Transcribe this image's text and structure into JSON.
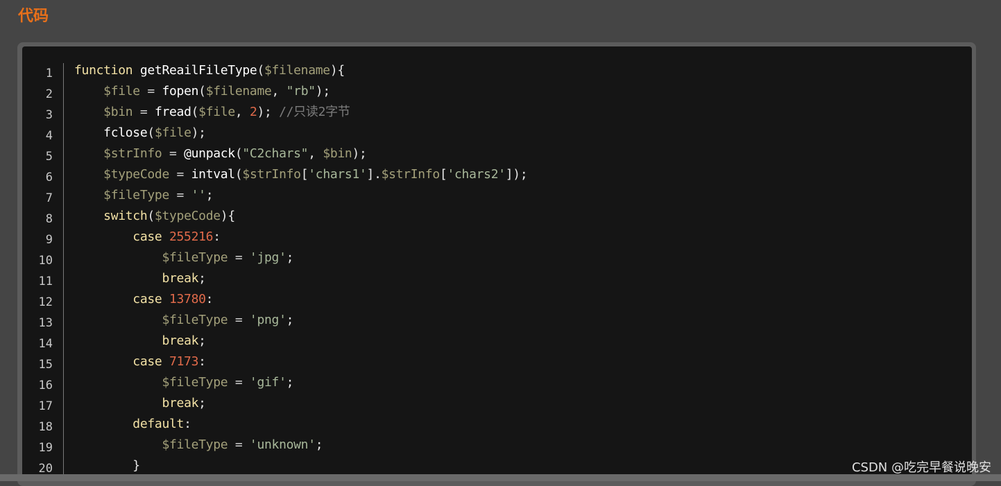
{
  "section_title": "代码",
  "watermark": "CSDN @吃完早餐说晚安",
  "code": {
    "line_numbers": [
      "1",
      "2",
      "3",
      "4",
      "5",
      "6",
      "7",
      "8",
      "9",
      "10",
      "11",
      "12",
      "13",
      "14",
      "15",
      "16",
      "17",
      "18",
      "19",
      "20"
    ],
    "lines": [
      [
        [
          "kw",
          "function "
        ],
        [
          "fn",
          "getReailFileType"
        ],
        [
          "punc",
          "("
        ],
        [
          "var",
          "$filename"
        ],
        [
          "punc",
          "){"
        ]
      ],
      [
        [
          "punc",
          "    "
        ],
        [
          "var",
          "$file"
        ],
        [
          "op",
          " = "
        ],
        [
          "fn",
          "fopen"
        ],
        [
          "punc",
          "("
        ],
        [
          "var",
          "$filename"
        ],
        [
          "punc",
          ", "
        ],
        [
          "str",
          "\"rb\""
        ],
        [
          "punc",
          ");"
        ]
      ],
      [
        [
          "punc",
          "    "
        ],
        [
          "var",
          "$bin"
        ],
        [
          "op",
          " = "
        ],
        [
          "fn",
          "fread"
        ],
        [
          "punc",
          "("
        ],
        [
          "var",
          "$file"
        ],
        [
          "punc",
          ", "
        ],
        [
          "num",
          "2"
        ],
        [
          "punc",
          "); "
        ],
        [
          "cm",
          "//只读2字节"
        ]
      ],
      [
        [
          "punc",
          "    "
        ],
        [
          "fn",
          "fclose"
        ],
        [
          "punc",
          "("
        ],
        [
          "var",
          "$file"
        ],
        [
          "punc",
          ");"
        ]
      ],
      [
        [
          "punc",
          "    "
        ],
        [
          "var",
          "$strInfo"
        ],
        [
          "op",
          " = "
        ],
        [
          "fn",
          "@unpack"
        ],
        [
          "punc",
          "("
        ],
        [
          "str",
          "\"C2chars\""
        ],
        [
          "punc",
          ", "
        ],
        [
          "var",
          "$bin"
        ],
        [
          "punc",
          ");"
        ]
      ],
      [
        [
          "punc",
          "    "
        ],
        [
          "var",
          "$typeCode"
        ],
        [
          "op",
          " = "
        ],
        [
          "fn",
          "intval"
        ],
        [
          "punc",
          "("
        ],
        [
          "var",
          "$strInfo"
        ],
        [
          "punc",
          "["
        ],
        [
          "str",
          "'chars1'"
        ],
        [
          "punc",
          "]."
        ],
        [
          "var",
          "$strInfo"
        ],
        [
          "punc",
          "["
        ],
        [
          "str",
          "'chars2'"
        ],
        [
          "punc",
          "]);"
        ]
      ],
      [
        [
          "punc",
          "    "
        ],
        [
          "var",
          "$fileType"
        ],
        [
          "op",
          " = "
        ],
        [
          "str",
          "''"
        ],
        [
          "punc",
          ";"
        ]
      ],
      [
        [
          "punc",
          "    "
        ],
        [
          "kw",
          "switch"
        ],
        [
          "punc",
          "("
        ],
        [
          "var",
          "$typeCode"
        ],
        [
          "punc",
          "){"
        ]
      ],
      [
        [
          "punc",
          "        "
        ],
        [
          "kw",
          "case "
        ],
        [
          "num",
          "255216"
        ],
        [
          "punc",
          ":"
        ]
      ],
      [
        [
          "punc",
          "            "
        ],
        [
          "var",
          "$fileType"
        ],
        [
          "op",
          " = "
        ],
        [
          "str",
          "'jpg'"
        ],
        [
          "punc",
          ";"
        ]
      ],
      [
        [
          "punc",
          "            "
        ],
        [
          "kw",
          "break"
        ],
        [
          "punc",
          ";"
        ]
      ],
      [
        [
          "punc",
          "        "
        ],
        [
          "kw",
          "case "
        ],
        [
          "num",
          "13780"
        ],
        [
          "punc",
          ":"
        ]
      ],
      [
        [
          "punc",
          "            "
        ],
        [
          "var",
          "$fileType"
        ],
        [
          "op",
          " = "
        ],
        [
          "str",
          "'png'"
        ],
        [
          "punc",
          ";"
        ]
      ],
      [
        [
          "punc",
          "            "
        ],
        [
          "kw",
          "break"
        ],
        [
          "punc",
          ";"
        ]
      ],
      [
        [
          "punc",
          "        "
        ],
        [
          "kw",
          "case "
        ],
        [
          "num",
          "7173"
        ],
        [
          "punc",
          ":"
        ]
      ],
      [
        [
          "punc",
          "            "
        ],
        [
          "var",
          "$fileType"
        ],
        [
          "op",
          " = "
        ],
        [
          "str",
          "'gif'"
        ],
        [
          "punc",
          ";"
        ]
      ],
      [
        [
          "punc",
          "            "
        ],
        [
          "kw",
          "break"
        ],
        [
          "punc",
          ";"
        ]
      ],
      [
        [
          "punc",
          "        "
        ],
        [
          "kw",
          "default"
        ],
        [
          "punc",
          ":"
        ]
      ],
      [
        [
          "punc",
          "            "
        ],
        [
          "var",
          "$fileType"
        ],
        [
          "op",
          " = "
        ],
        [
          "str",
          "'unknown'"
        ],
        [
          "punc",
          ";"
        ]
      ],
      [
        [
          "punc",
          "        }"
        ]
      ]
    ]
  },
  "colors": {
    "page_bg": "#454545",
    "title": "#e8701a",
    "code_bg": "#151515",
    "keyword": "#f2e1a5",
    "function": "#ffffff",
    "variable": "#a3a07a",
    "string": "#a8b89a",
    "number": "#e06a4a",
    "comment": "#7c7c7c"
  }
}
